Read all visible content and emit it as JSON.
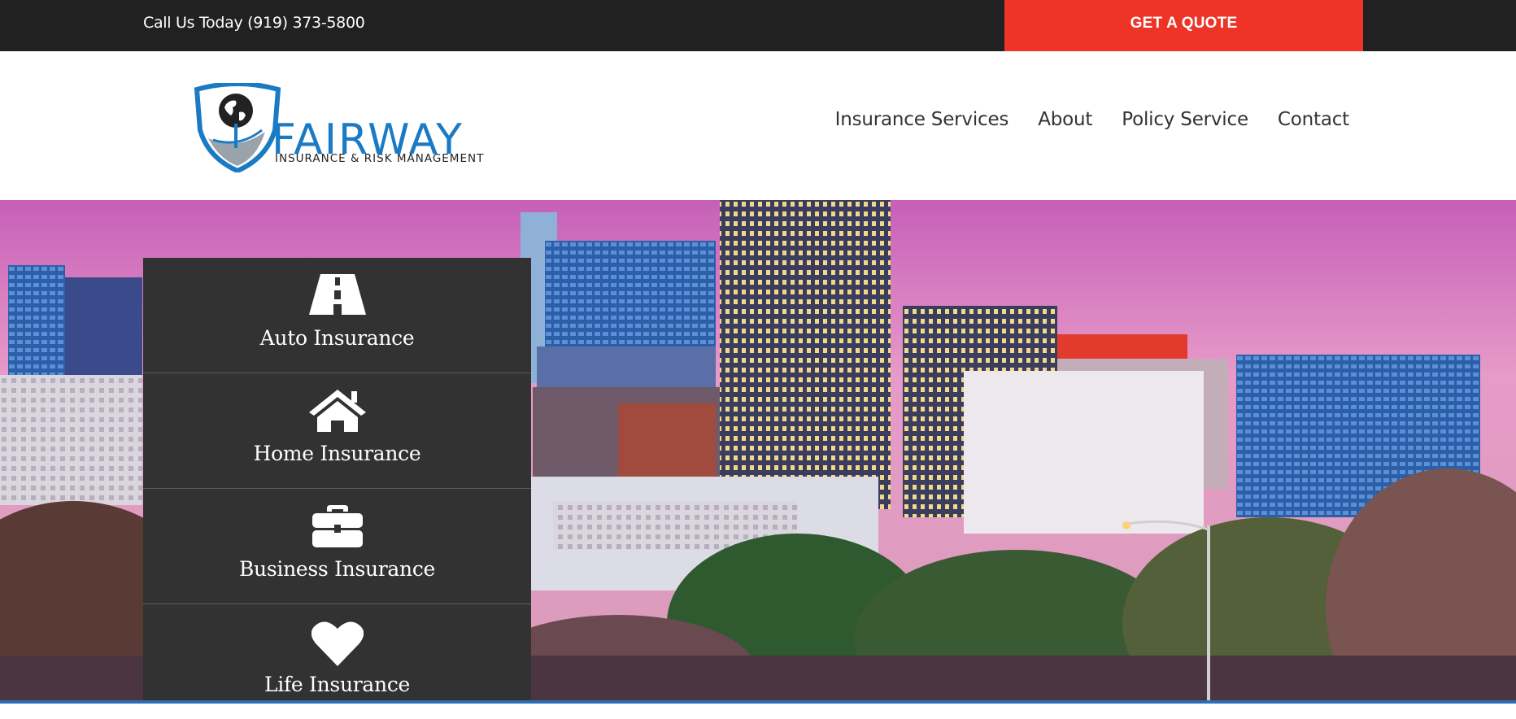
{
  "topbar": {
    "phone_text": "Call Us Today (919) 373-5800",
    "quote_label": "GET A QUOTE",
    "quote_color": "#ee3327"
  },
  "logo": {
    "name": "FAIRWAY",
    "tagline": "INSURANCE & RISK MANAGEMENT",
    "brand_color": "#1a7bc4",
    "icon": "shield-globe-icon"
  },
  "nav": {
    "items": [
      {
        "label": "Insurance Services"
      },
      {
        "label": "About"
      },
      {
        "label": "Policy Service"
      },
      {
        "label": "Contact"
      }
    ]
  },
  "panel": {
    "items": [
      {
        "label": "Auto Insurance",
        "icon": "road-icon"
      },
      {
        "label": "Home Insurance",
        "icon": "home-icon"
      },
      {
        "label": "Business Insurance",
        "icon": "briefcase-icon"
      },
      {
        "label": "Life Insurance",
        "icon": "heart-icon"
      }
    ]
  }
}
